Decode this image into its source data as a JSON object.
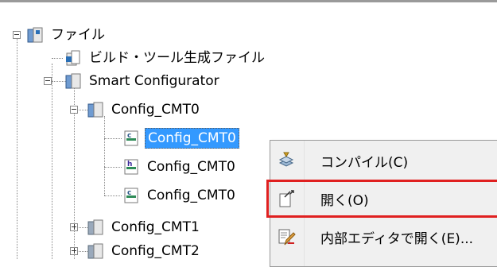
{
  "tree": {
    "root_label": "ファイル",
    "build_tool_label": "ビルド・ツール生成ファイル",
    "smart_configurator_label": "Smart Configurator",
    "config_cmt0_folder_label": "Config_CMT0",
    "child_files": [
      "Config_CMT0",
      "Config_CMT0",
      "Config_CMT0"
    ],
    "config_cmt1_label": "Config_CMT1",
    "config_cmt2_label": "Config_CMT2"
  },
  "context_menu": {
    "items": [
      {
        "label": "コンパイル(C)",
        "icon": "compile-icon"
      },
      {
        "label": "開く(O)",
        "icon": "open-icon"
      },
      {
        "label": "内部エディタで開く(E)...",
        "icon": "internal-editor-icon"
      }
    ]
  },
  "colors": {
    "selection": "#3399ff",
    "highlight_box": "#e02020",
    "menu_background": "#f0f0f0"
  }
}
